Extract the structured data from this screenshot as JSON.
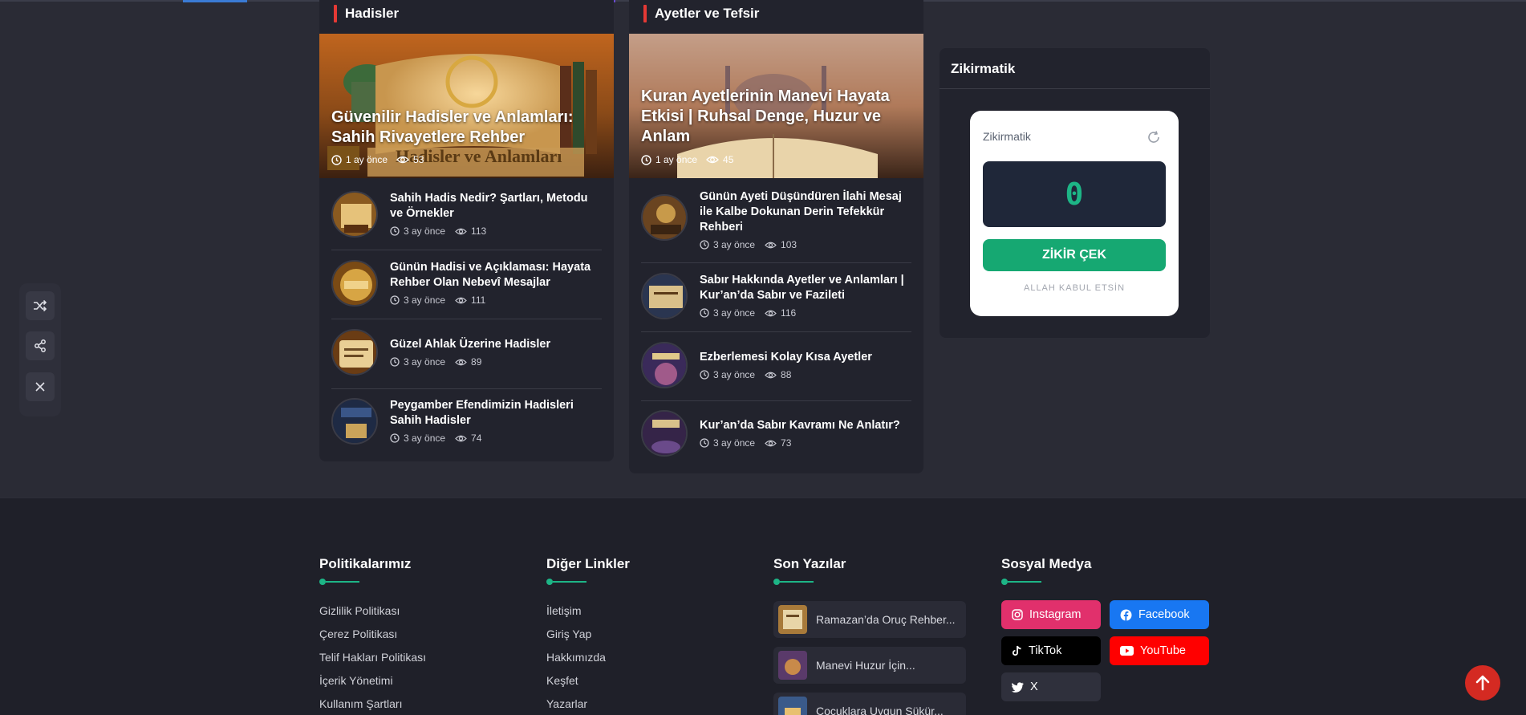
{
  "colors": {
    "accent": "#e53935",
    "green": "#1db586",
    "background": "#2a2b35",
    "panel": "#22232d"
  },
  "hadisler": {
    "title": "Hadisler",
    "hero": {
      "title": "Güvenilir Hadisler ve Anlamları: Sahih Rivayetlere Rehber",
      "time": "1 ay önce",
      "views": "53",
      "image_text": "Hadisler ve Anlamları"
    },
    "items": [
      {
        "title": "Sahih Hadis Nedir? Şartları, Metodu ve Örnekler",
        "time": "3 ay önce",
        "views": "113"
      },
      {
        "title": "Günün Hadisi ve Açıklaması: Hayata Rehber Olan Nebevî Mesajlar",
        "time": "3 ay önce",
        "views": "111"
      },
      {
        "title": "Güzel Ahlak Üzerine Hadisler",
        "time": "3 ay önce",
        "views": "89"
      },
      {
        "title": "Peygamber Efendimizin Hadisleri Sahih Hadisler",
        "time": "3 ay önce",
        "views": "74"
      }
    ]
  },
  "ayetler": {
    "title": "Ayetler ve Tefsir",
    "hero": {
      "title": "Kuran Ayetlerinin Manevi Hayata Etkisi | Ruhsal Denge, Huzur ve Anlam",
      "time": "1 ay önce",
      "views": "45"
    },
    "items": [
      {
        "title": "Günün Ayeti Düşündüren İlahi Mesaj ile Kalbe Dokunan Derin Tefekkür Rehberi",
        "time": "3 ay önce",
        "views": "103"
      },
      {
        "title": "Sabır Hakkında Ayetler ve Anlamları | Kur’an’da Sabır ve Fazileti",
        "time": "3 ay önce",
        "views": "116"
      },
      {
        "title": "Ezberlemesi Kolay Kısa Ayetler",
        "time": "3 ay önce",
        "views": "88"
      },
      {
        "title": "Kur’an’da Sabır Kavramı Ne Anlatır?",
        "time": "3 ay önce",
        "views": "73"
      }
    ]
  },
  "zikirmatik": {
    "panel_title": "Zikirmatik",
    "label": "Zikirmatik",
    "count": "0",
    "button": "ZİKİR ÇEK",
    "footer": "ALLAH KABUL ETSİN"
  },
  "float_bar": {
    "icons": [
      "shuffle-icon",
      "share-icon",
      "close-icon"
    ]
  },
  "footer": {
    "politikalar": {
      "title": "Politikalarımız",
      "links": [
        "Gizlilik Politikası",
        "Çerez Politikası",
        "Telif Hakları Politikası",
        "İçerik Yönetimi",
        "Kullanım Şartları"
      ]
    },
    "diger": {
      "title": "Diğer Linkler",
      "links": [
        "İletişim",
        "Giriş Yap",
        "Hakkımızda",
        "Keşfet",
        "Yazarlar"
      ]
    },
    "son_yazilar": {
      "title": "Son Yazılar",
      "items": [
        "Ramazan’da Oruç Rehber...",
        "Manevi Huzur İçin...",
        "Çocuklara Uygun Şükür..."
      ]
    },
    "sosyal": {
      "title": "Sosyal Medya",
      "instagram": "Instagram",
      "facebook": "Facebook",
      "tiktok": "TikTok",
      "youtube": "YouTube",
      "x": "X"
    }
  }
}
